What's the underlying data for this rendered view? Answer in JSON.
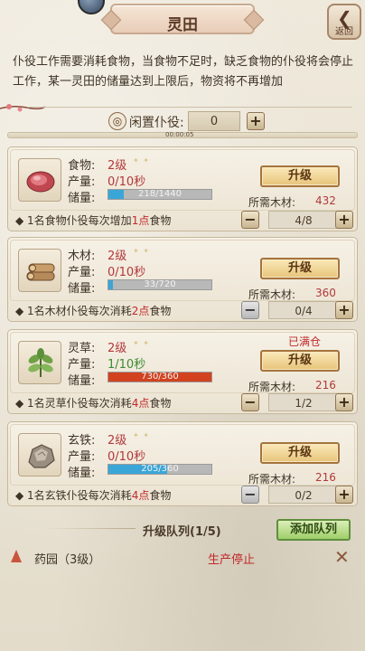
{
  "header": {
    "title": "灵田",
    "back_label": "返回"
  },
  "description": "仆役工作需要消耗食物，当食物不足时，缺乏食物的仆役将会停止工作，某一灵田的储量达到上限后，物资将不再增加",
  "idle": {
    "label": "闲置仆役:",
    "value": "0",
    "timer": "00:00:05"
  },
  "labels": {
    "output": "产量:",
    "storage": "储量:",
    "upgrade": "升级",
    "cost": "所需木材:",
    "plus": "+",
    "minus": "−"
  },
  "resources": [
    {
      "name": "食物:",
      "level": "2级",
      "output": "0/10秒",
      "storage_text": "218/1440",
      "storage_fraction": 0.151,
      "bar_color": "#3aa6d8",
      "cost": "432",
      "full_label": "",
      "footer_pre": "1名食物仆役每次增加",
      "footer_red": "1点",
      "footer_post": "食物",
      "alloc": "4/8",
      "icon": "meat-icon"
    },
    {
      "name": "木材:",
      "level": "2级",
      "output": "0/10秒",
      "storage_text": "33/720",
      "storage_fraction": 0.046,
      "bar_color": "#3aa6d8",
      "cost": "360",
      "full_label": "",
      "footer_pre": "1名木材仆役每次消耗",
      "footer_red": "2点",
      "footer_post": "食物",
      "alloc": "0/4",
      "icon": "wood-icon"
    },
    {
      "name": "灵草:",
      "level": "2级",
      "output": "1/10秒",
      "storage_text": "730/360",
      "storage_fraction": 1.0,
      "bar_color": "#d2421f",
      "cost": "216",
      "full_label": "已满仓",
      "footer_pre": "1名灵草仆役每次消耗",
      "footer_red": "4点",
      "footer_post": "食物",
      "alloc": "1/2",
      "icon": "herb-icon"
    },
    {
      "name": "玄铁:",
      "level": "2级",
      "output": "0/10秒",
      "storage_text": "205/360",
      "storage_fraction": 0.569,
      "bar_color": "#3aa6d8",
      "cost": "216",
      "full_label": "",
      "footer_pre": "1名玄铁仆役每次消耗",
      "footer_red": "4点",
      "footer_post": "食物",
      "alloc": "0/2",
      "icon": "iron-ore-icon"
    }
  ],
  "queue": {
    "title": "升级队列(1/5)",
    "add_label": "添加队列",
    "item_name": "药园（3级）",
    "item_status": "生产停止"
  }
}
